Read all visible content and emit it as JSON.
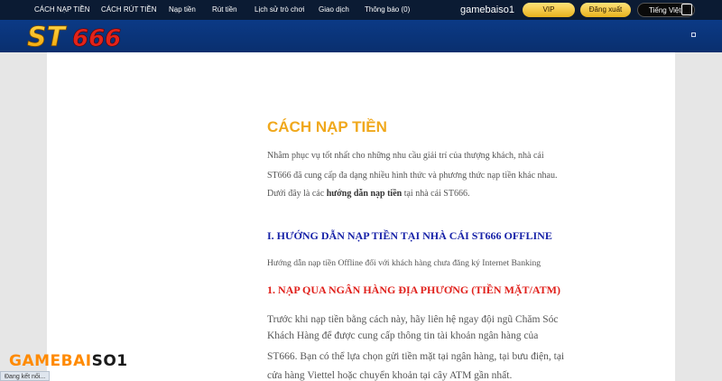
{
  "topnav": {
    "items": [
      {
        "label": "CÁCH NẠP TIỀN"
      },
      {
        "label": "CÁCH RÚT TIỀN"
      },
      {
        "label": "Nạp tiền"
      },
      {
        "label": "Rút tiền"
      },
      {
        "label": "Lịch sử trò chơi"
      },
      {
        "label": "Giao dịch"
      },
      {
        "label": "Thông báo (0)"
      }
    ],
    "username": "gamebaiso1",
    "vip_label": "VIP",
    "logout_label": "Đăng xuất",
    "language_label": "Tiếng Việt"
  },
  "header": {
    "logo_text": "ST666",
    "logo_color": "#f5b400",
    "logo_accent_color": "#e2231a"
  },
  "article": {
    "title": "CÁCH NẠP TIỀN",
    "intro_line1": "Nhằm phục vụ tốt nhất cho những nhu cầu giải trí của thượng khách, nhà cái",
    "intro_line2": "ST666 đã cung cấp đa dạng nhiều hình thức và phương thức nạp tiền khác nhau.",
    "intro_line3_pre": "Dưới đây là các ",
    "intro_line3_bold": "hướng dẫn nạp tiền",
    "intro_line3_post": " tại nhà cái ST666.",
    "section1_heading": "I. HƯỚNG DẪN NẠP TIỀN TẠI NHÀ CÁI ST666 OFFLINE",
    "section1_text": "Hướng dẫn nạp tiền Offline đối với khách hàng chưa đăng ký Internet Banking",
    "sub1_heading": "1. NẠP QUA NGÂN HÀNG ĐỊA PHƯƠNG (TIỀN MẶT/ATM)",
    "sub1_line1": "Trước khi nạp tiền bằng cách này, hãy liên hệ ngay đội ngũ Chăm Sóc",
    "sub1_line2": "Khách Hàng để được cung cấp thông tin tài khoản ngân hàng của",
    "sub1_line3": "ST666. Bạn có thể lựa chọn gửi tiền mặt tại ngân hàng, tại bưu điện, tại",
    "sub1_line4": "cửa hàng Viettel hoặc chuyển khoản tại cây ATM gần nhất."
  },
  "watermark": {
    "part1": "GAMEBAI",
    "part2": "SO1"
  },
  "status_bar": {
    "text": "Đang kết nối..."
  }
}
